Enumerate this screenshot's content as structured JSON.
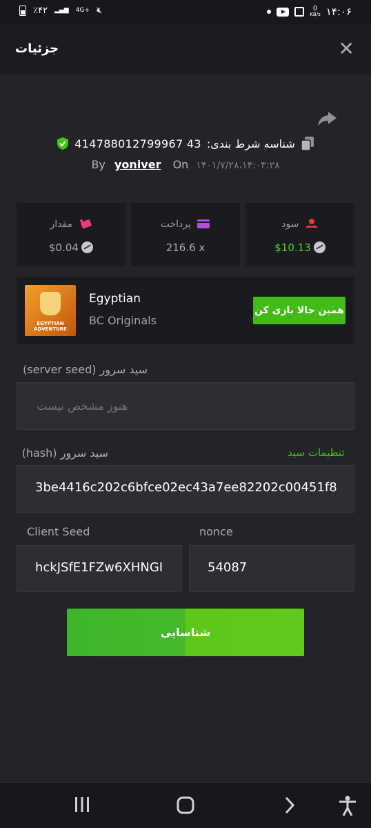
{
  "status_bar": {
    "time": "۱۴:۰۶",
    "speed": "0",
    "speed_unit": "KB/s",
    "network": "4G+",
    "battery": "٪۴۲"
  },
  "header": {
    "title": "جزئیات",
    "close_icon": "close-icon"
  },
  "bet": {
    "id_label": "شناسه شرط بندی:",
    "id": "414788012799967 43",
    "by_label": "By",
    "user": "yoniver",
    "on_label": "On",
    "date": "۱۴۰۱/۷/۲۸،۱۴:۰۳:۲۸"
  },
  "stats": {
    "amount": {
      "label": "مقدار",
      "value": "$0.04",
      "icon": "bet-icon"
    },
    "payout": {
      "label": "پرداخت",
      "value": "216.6 x",
      "icon": "card-icon"
    },
    "profit": {
      "label": "سود",
      "value": "$10.13",
      "icon": "profit-icon"
    }
  },
  "game": {
    "name": "Egyptian",
    "provider": "BC Originals",
    "thumb_text_1": "EGYPTIAN",
    "thumb_text_2": "ADVENTURE",
    "play_label": "همین حالا بازی کن"
  },
  "fairness": {
    "server_seed_label": "سید سرور (server seed)",
    "server_seed_value": "هنوز مشخص نیست",
    "hash_label": "سید سرور (hash)",
    "seed_settings": "تنظیمات سید",
    "hash_value": "3be4416c202c6bfce02ec43a7ee82202c00451f8",
    "client_seed_label": "Client Seed",
    "client_seed_value": "hckJSfE1FZw6XHNGI",
    "nonce_label": "nonce",
    "nonce_value": "54087"
  },
  "verify_label": "شناسایی",
  "colors": {
    "accent_green": "#43bb16",
    "profit_green": "#5ad023",
    "background": "#232427",
    "card": "#1a1b1e"
  }
}
